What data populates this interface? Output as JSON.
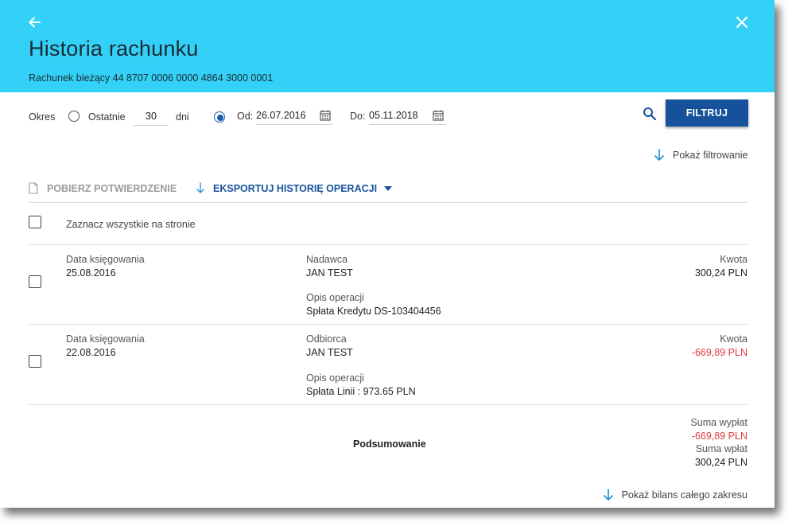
{
  "header": {
    "title": "Historia rachunku",
    "account": "Rachunek bieżący 44 8707 0006 0000 4864 3000 0001"
  },
  "filter": {
    "period_label": "Okres",
    "last_label": "Ostatnie",
    "last_value": "30",
    "days_label": "dni",
    "from_label": "Od:",
    "from_value": "26.07.2016",
    "to_label": "Do:",
    "to_value": "05.11.2018",
    "filter_button": "FILTRUJ",
    "show_filtering": "Pokaż filtrowanie"
  },
  "actions": {
    "download_confirmation": "POBIERZ POTWIERDZENIE",
    "export_history": "EKSPORTUJ HISTORIĘ OPERACJI"
  },
  "select_all_label": "Zaznacz wszystkie na stronie",
  "transactions": [
    {
      "date_label": "Data księgowania",
      "date": "25.08.2016",
      "party_label": "Nadawca",
      "party": "JAN TEST",
      "desc_label": "Opis operacji",
      "desc": "Spłata Kredytu DS-103404456",
      "amount_label": "Kwota",
      "amount": "300,24",
      "currency": "PLN"
    },
    {
      "date_label": "Data księgowania",
      "date": "22.08.2016",
      "party_label": "Odbiorca",
      "party": "JAN TEST",
      "desc_label": "Opis operacji",
      "desc": "Spłata Linii : 973.65 PLN",
      "amount_label": "Kwota",
      "amount": "-669,89",
      "currency": "PLN"
    }
  ],
  "summary": {
    "label": "Podsumowanie",
    "withdrawals_label": "Suma wypłat",
    "withdrawals": "-669,89",
    "withdrawals_currency": "PLN",
    "deposits_label": "Suma wpłat",
    "deposits": "300,24",
    "deposits_currency": "PLN",
    "show_balance": "Pokaż bilans całego zakresu"
  },
  "colors": {
    "header_bg": "#33d1f7",
    "primary": "#16529c",
    "link_icon": "#1a8fd6",
    "negative": "#e23b3b"
  }
}
